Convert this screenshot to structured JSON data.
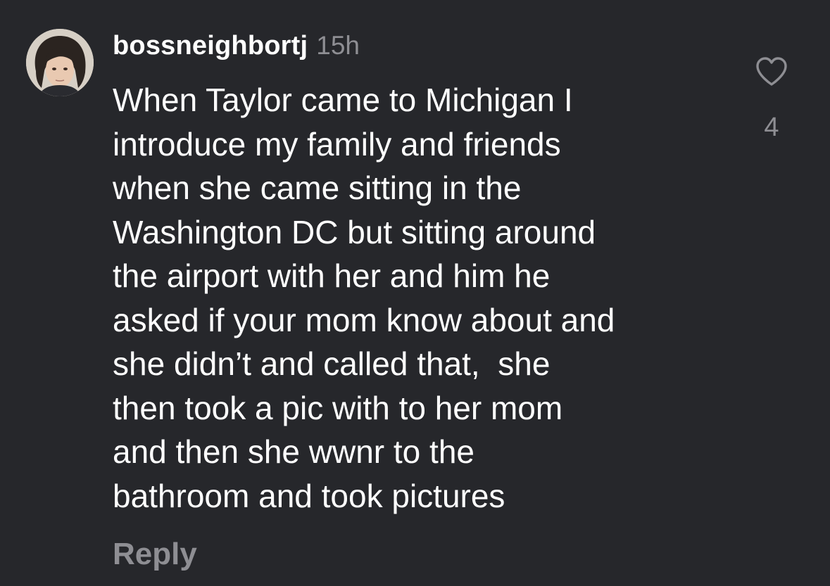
{
  "comment": {
    "username": "bossneighbortj",
    "timestamp": "15h",
    "lines": [
      "When Taylor came to Michigan I",
      "introduce my family and friends",
      "when she came sitting in the",
      "Washington DC but sitting around",
      "the airport with her and him he",
      "asked if your mom know about and",
      "she didn’t and called that,  she",
      "then took a pic with to her mom",
      "and then she wwnr to the",
      "bathroom and took pictures"
    ],
    "reply_label": "Reply",
    "like_count": "4",
    "like_icon": "heart-outline-icon",
    "avatar": "user-avatar"
  },
  "colors": {
    "background": "#26272b",
    "text": "#ffffff",
    "secondary_text": "#8e8e93"
  }
}
